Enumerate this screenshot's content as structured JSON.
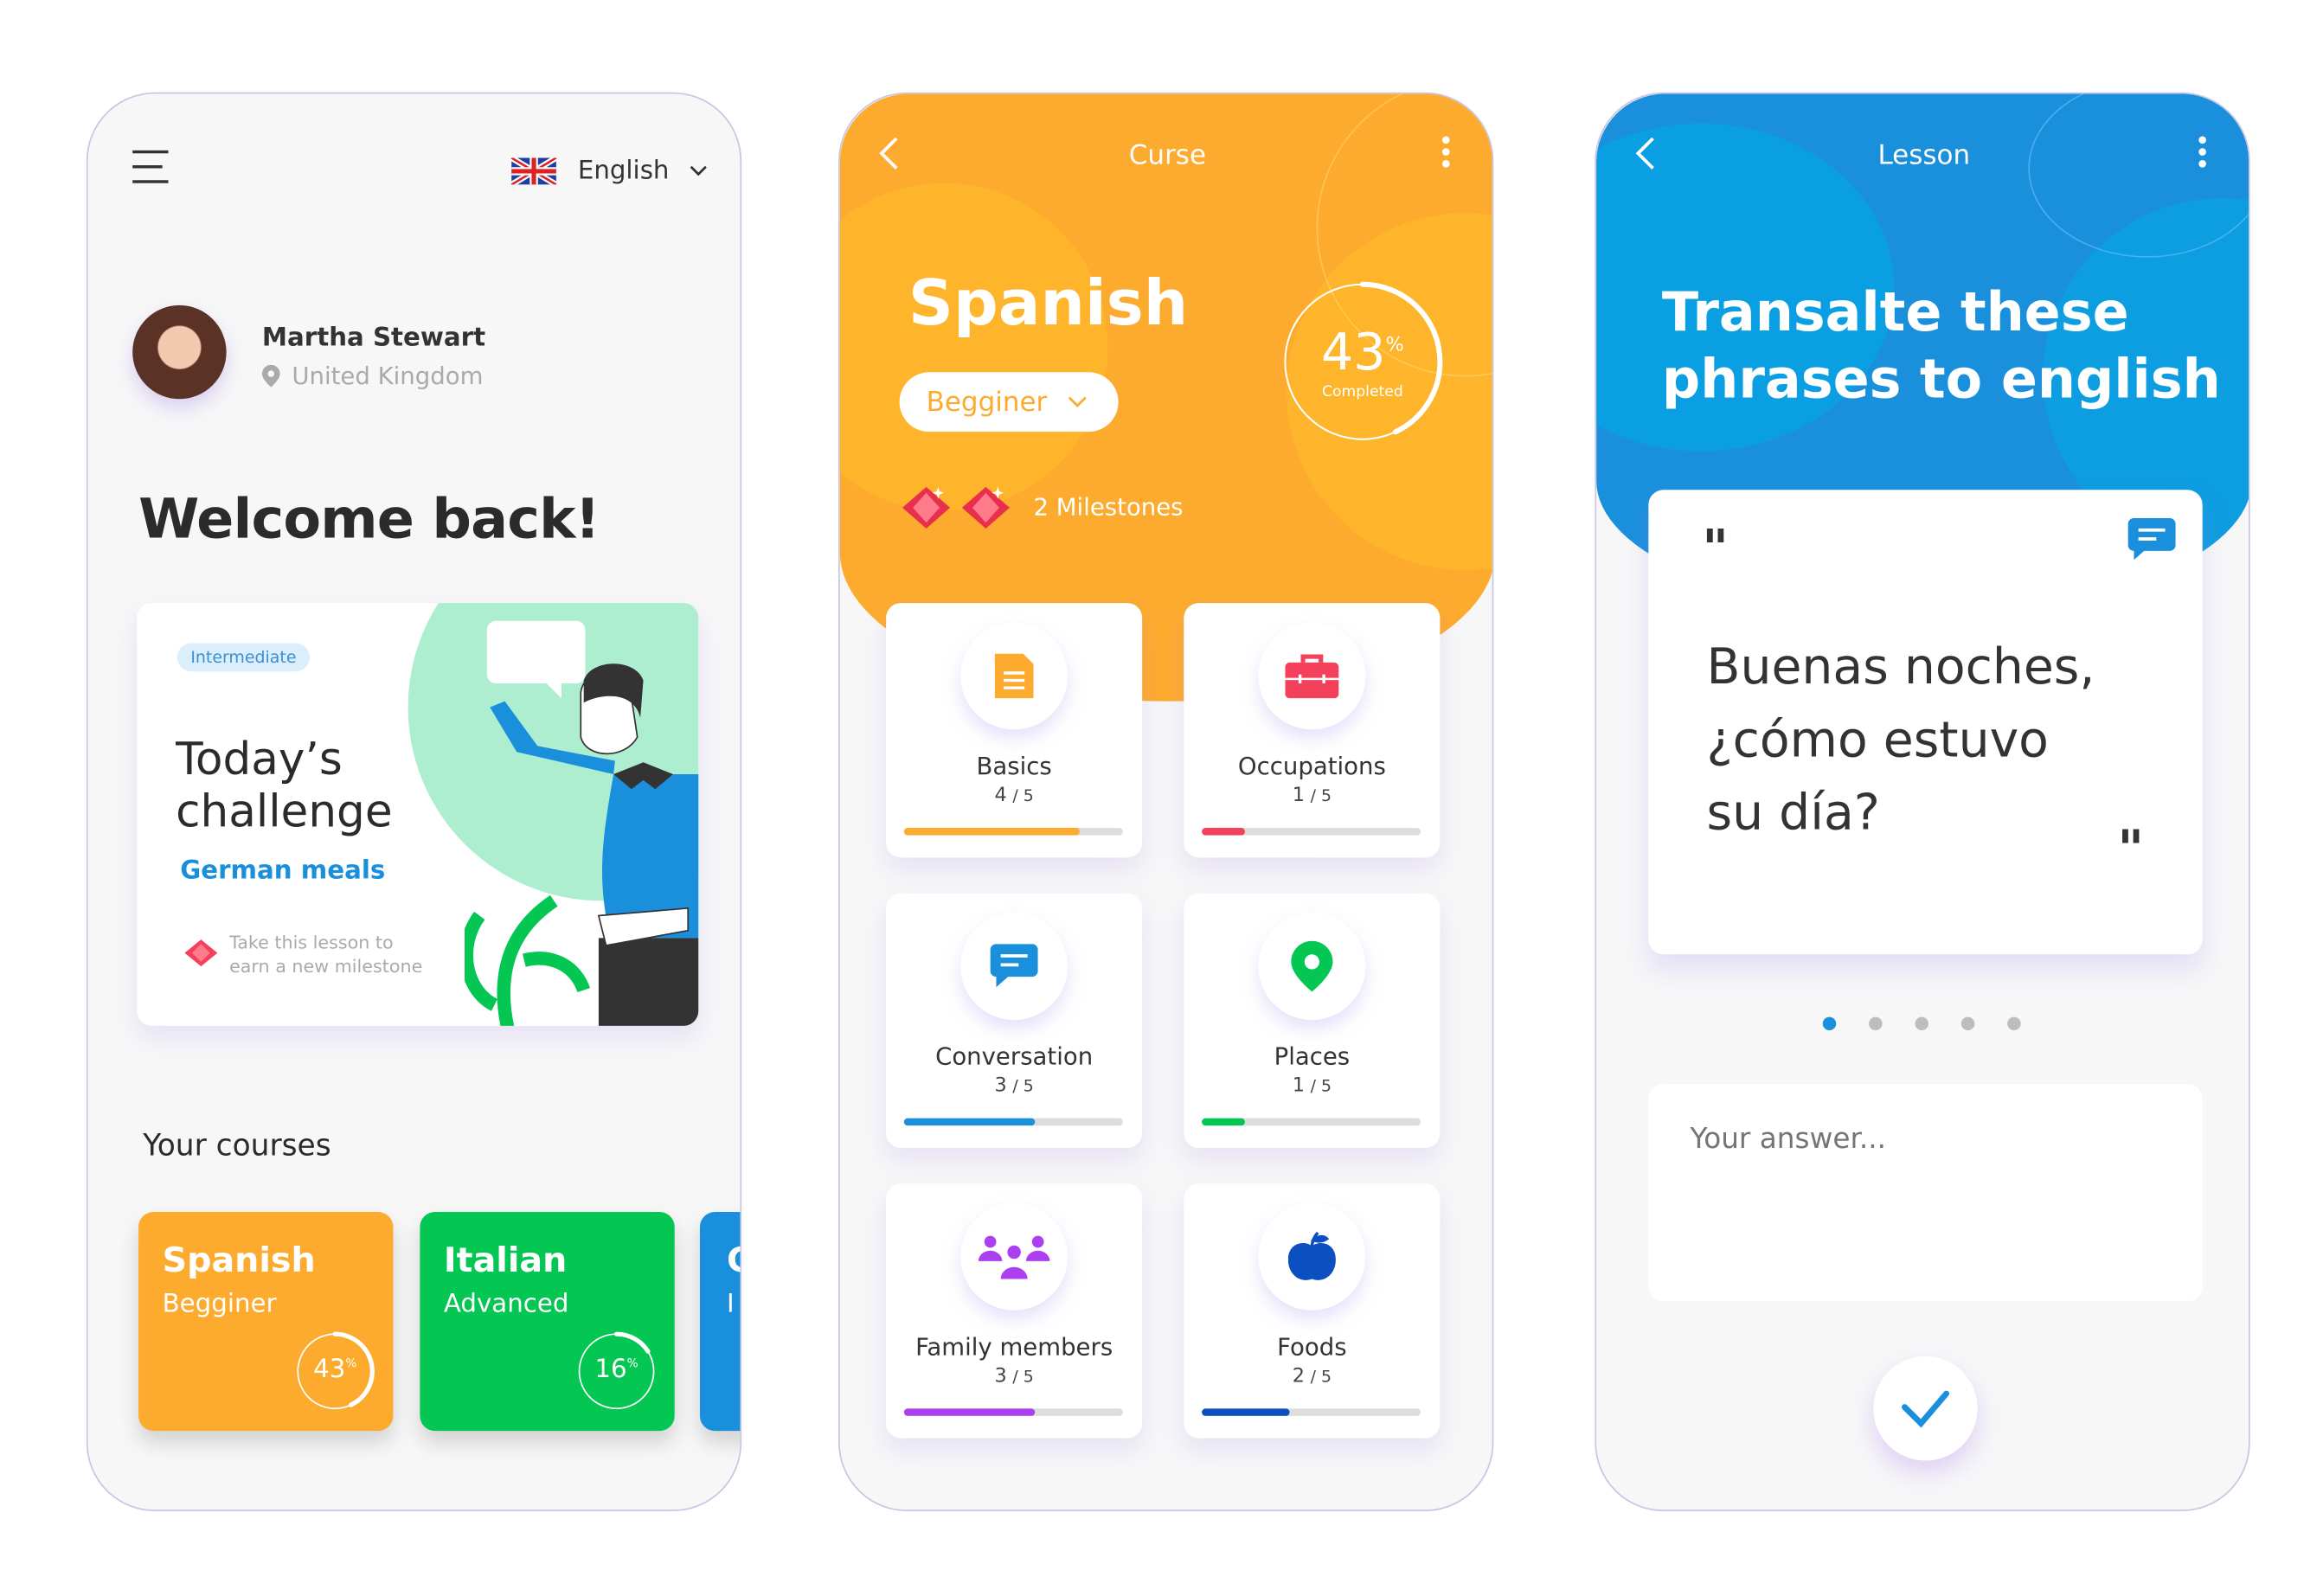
{
  "colors": {
    "orange": "#fdab2e",
    "green": "#04c653",
    "blue": "#1a90dd",
    "red": "#f4405a",
    "purple": "#ac40f0",
    "navy": "#0b4fc0"
  },
  "home": {
    "language": "English",
    "flag_icon": "uk-flag-icon",
    "user": {
      "name": "Martha Stewart",
      "location": "United Kingdom"
    },
    "welcome": "Welcome back!",
    "challenge": {
      "badge": "Intermediate",
      "title_line1": "Today’s",
      "title_line2": "challenge",
      "topic": "German meals",
      "note_line1": "Take this lesson to",
      "note_line2": "earn a new milestone"
    },
    "courses_title": "Your courses",
    "courses": [
      {
        "name": "Spanish",
        "level": "Begginer",
        "percent": 43,
        "percent_label": "43",
        "color": "#fdab2e"
      },
      {
        "name": "Italian",
        "level": "Advanced",
        "percent": 16,
        "percent_label": "16",
        "color": "#04c653"
      },
      {
        "name": "G",
        "level": "I",
        "color": "#1a90dd"
      }
    ]
  },
  "course": {
    "header_title": "Curse",
    "language": "Spanish",
    "level": "Begginer",
    "percent": 43,
    "percent_label": "43",
    "percent_sign": "%",
    "completed_label": "Completed",
    "milestones": "2 Milestones",
    "topics": [
      {
        "label": "Basics",
        "done": 4,
        "total": 5,
        "count": "4",
        "of": "/ 5",
        "icon": "document-icon",
        "color": "#fdab2e"
      },
      {
        "label": "Occupations",
        "done": 1,
        "total": 5,
        "count": "1",
        "of": "/ 5",
        "icon": "briefcase-icon",
        "color": "#f4405a"
      },
      {
        "label": "Conversation",
        "done": 3,
        "total": 5,
        "count": "3",
        "of": "/ 5",
        "icon": "chat-icon",
        "color": "#1a90dd"
      },
      {
        "label": "Places",
        "done": 1,
        "total": 5,
        "count": "1",
        "of": "/ 5",
        "icon": "location-pin-icon",
        "color": "#04c653"
      },
      {
        "label": "Family members",
        "done": 3,
        "total": 5,
        "count": "3",
        "of": "/ 5",
        "icon": "people-icon",
        "color": "#ac40f0"
      },
      {
        "label": "Foods",
        "done": 2,
        "total": 5,
        "count": "2",
        "of": "/ 5",
        "icon": "apple-icon",
        "color": "#0b4fc0"
      }
    ]
  },
  "lesson": {
    "header_title": "Lesson",
    "title_line1": "Transalte these",
    "title_line2": "phrases to english",
    "quote_open": "\"",
    "quote_close": "\"",
    "phrase_line1": "Buenas noches,",
    "phrase_line2": "¿cómo estuvo",
    "phrase_line3": "su día?",
    "pager": {
      "total": 5,
      "active": 1
    },
    "answer_placeholder": "Your answer..."
  }
}
